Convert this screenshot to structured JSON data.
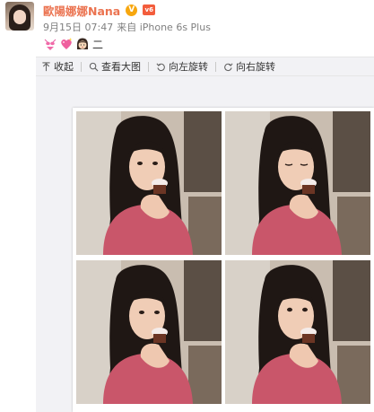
{
  "post": {
    "author": {
      "name": "歐陽娜娜Nana",
      "verified_mark": "V",
      "vip_mark": "v6"
    },
    "meta": {
      "date": "9月15日 07:47",
      "via": "来自 iPhone 6s Plus"
    },
    "content": {
      "emojis": [
        "bikini-emoji",
        "sparkling-heart-emoji",
        "girl-face-emoji"
      ],
      "text": "二"
    }
  },
  "toolbar": {
    "items": [
      {
        "label": "收起",
        "icon": "arrow-up-icon"
      },
      {
        "label": "查看大图",
        "icon": "search-icon"
      },
      {
        "label": "向左旋转",
        "icon": "rotate-left-icon"
      },
      {
        "label": "向右旋转",
        "icon": "rotate-right-icon"
      }
    ]
  },
  "media": {
    "layout": "2x2 photo collage",
    "photos": [
      {
        "pose": "eyes-forward"
      },
      {
        "pose": "eyes-closed"
      },
      {
        "pose": "eyes-right"
      },
      {
        "pose": "eyes-up"
      }
    ]
  },
  "colors": {
    "name": "#eb7350",
    "meta": "#808080",
    "toolbar_bg": "#f2f2f5",
    "badge_v": "#f7a70f",
    "badge_vip": "#f35d3c"
  }
}
